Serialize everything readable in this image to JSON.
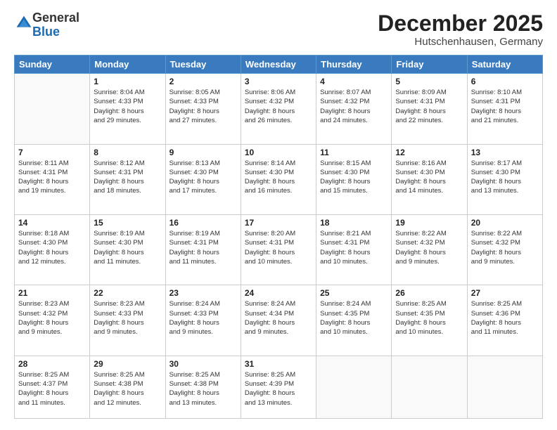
{
  "logo": {
    "general": "General",
    "blue": "Blue"
  },
  "header": {
    "month": "December 2025",
    "location": "Hutschenhausen, Germany"
  },
  "weekdays": [
    "Sunday",
    "Monday",
    "Tuesday",
    "Wednesday",
    "Thursday",
    "Friday",
    "Saturday"
  ],
  "weeks": [
    [
      {
        "day": "",
        "info": ""
      },
      {
        "day": "1",
        "info": "Sunrise: 8:04 AM\nSunset: 4:33 PM\nDaylight: 8 hours\nand 29 minutes."
      },
      {
        "day": "2",
        "info": "Sunrise: 8:05 AM\nSunset: 4:33 PM\nDaylight: 8 hours\nand 27 minutes."
      },
      {
        "day": "3",
        "info": "Sunrise: 8:06 AM\nSunset: 4:32 PM\nDaylight: 8 hours\nand 26 minutes."
      },
      {
        "day": "4",
        "info": "Sunrise: 8:07 AM\nSunset: 4:32 PM\nDaylight: 8 hours\nand 24 minutes."
      },
      {
        "day": "5",
        "info": "Sunrise: 8:09 AM\nSunset: 4:31 PM\nDaylight: 8 hours\nand 22 minutes."
      },
      {
        "day": "6",
        "info": "Sunrise: 8:10 AM\nSunset: 4:31 PM\nDaylight: 8 hours\nand 21 minutes."
      }
    ],
    [
      {
        "day": "7",
        "info": "Sunrise: 8:11 AM\nSunset: 4:31 PM\nDaylight: 8 hours\nand 19 minutes."
      },
      {
        "day": "8",
        "info": "Sunrise: 8:12 AM\nSunset: 4:31 PM\nDaylight: 8 hours\nand 18 minutes."
      },
      {
        "day": "9",
        "info": "Sunrise: 8:13 AM\nSunset: 4:30 PM\nDaylight: 8 hours\nand 17 minutes."
      },
      {
        "day": "10",
        "info": "Sunrise: 8:14 AM\nSunset: 4:30 PM\nDaylight: 8 hours\nand 16 minutes."
      },
      {
        "day": "11",
        "info": "Sunrise: 8:15 AM\nSunset: 4:30 PM\nDaylight: 8 hours\nand 15 minutes."
      },
      {
        "day": "12",
        "info": "Sunrise: 8:16 AM\nSunset: 4:30 PM\nDaylight: 8 hours\nand 14 minutes."
      },
      {
        "day": "13",
        "info": "Sunrise: 8:17 AM\nSunset: 4:30 PM\nDaylight: 8 hours\nand 13 minutes."
      }
    ],
    [
      {
        "day": "14",
        "info": "Sunrise: 8:18 AM\nSunset: 4:30 PM\nDaylight: 8 hours\nand 12 minutes."
      },
      {
        "day": "15",
        "info": "Sunrise: 8:19 AM\nSunset: 4:30 PM\nDaylight: 8 hours\nand 11 minutes."
      },
      {
        "day": "16",
        "info": "Sunrise: 8:19 AM\nSunset: 4:31 PM\nDaylight: 8 hours\nand 11 minutes."
      },
      {
        "day": "17",
        "info": "Sunrise: 8:20 AM\nSunset: 4:31 PM\nDaylight: 8 hours\nand 10 minutes."
      },
      {
        "day": "18",
        "info": "Sunrise: 8:21 AM\nSunset: 4:31 PM\nDaylight: 8 hours\nand 10 minutes."
      },
      {
        "day": "19",
        "info": "Sunrise: 8:22 AM\nSunset: 4:32 PM\nDaylight: 8 hours\nand 9 minutes."
      },
      {
        "day": "20",
        "info": "Sunrise: 8:22 AM\nSunset: 4:32 PM\nDaylight: 8 hours\nand 9 minutes."
      }
    ],
    [
      {
        "day": "21",
        "info": "Sunrise: 8:23 AM\nSunset: 4:32 PM\nDaylight: 8 hours\nand 9 minutes."
      },
      {
        "day": "22",
        "info": "Sunrise: 8:23 AM\nSunset: 4:33 PM\nDaylight: 8 hours\nand 9 minutes."
      },
      {
        "day": "23",
        "info": "Sunrise: 8:24 AM\nSunset: 4:33 PM\nDaylight: 8 hours\nand 9 minutes."
      },
      {
        "day": "24",
        "info": "Sunrise: 8:24 AM\nSunset: 4:34 PM\nDaylight: 8 hours\nand 9 minutes."
      },
      {
        "day": "25",
        "info": "Sunrise: 8:24 AM\nSunset: 4:35 PM\nDaylight: 8 hours\nand 10 minutes."
      },
      {
        "day": "26",
        "info": "Sunrise: 8:25 AM\nSunset: 4:35 PM\nDaylight: 8 hours\nand 10 minutes."
      },
      {
        "day": "27",
        "info": "Sunrise: 8:25 AM\nSunset: 4:36 PM\nDaylight: 8 hours\nand 11 minutes."
      }
    ],
    [
      {
        "day": "28",
        "info": "Sunrise: 8:25 AM\nSunset: 4:37 PM\nDaylight: 8 hours\nand 11 minutes."
      },
      {
        "day": "29",
        "info": "Sunrise: 8:25 AM\nSunset: 4:38 PM\nDaylight: 8 hours\nand 12 minutes."
      },
      {
        "day": "30",
        "info": "Sunrise: 8:25 AM\nSunset: 4:38 PM\nDaylight: 8 hours\nand 13 minutes."
      },
      {
        "day": "31",
        "info": "Sunrise: 8:25 AM\nSunset: 4:39 PM\nDaylight: 8 hours\nand 13 minutes."
      },
      {
        "day": "",
        "info": ""
      },
      {
        "day": "",
        "info": ""
      },
      {
        "day": "",
        "info": ""
      }
    ]
  ]
}
